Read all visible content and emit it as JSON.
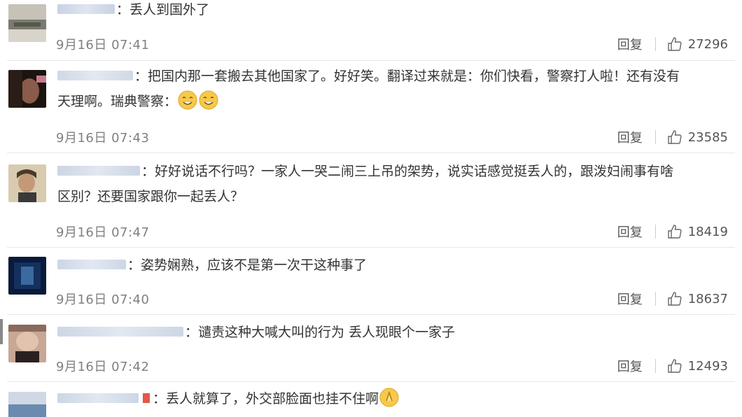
{
  "comments": [
    {
      "text": "：丢人到国外了",
      "time": "9月16日 07:41",
      "reply": "回复",
      "likes": "27296",
      "avatar_colors": [
        "#7a7a70",
        "#c7c2b8"
      ]
    },
    {
      "text": "：把国内那一套搬去其他国家了。好好笑。翻译过来就是：你们快看，警察打人啦！还有没有",
      "text2": "天理啊。瑞典警察：",
      "time": "9月16日 07:43",
      "reply": "回复",
      "likes": "23585",
      "avatar_colors": [
        "#1c1410",
        "#8a5a4a"
      ]
    },
    {
      "text": "：好好说话不行吗？一家人一哭二闹三上吊的架势，说实话感觉挺丢人的，跟泼妇闹事有啥",
      "text2": "区别？还要国家跟你一起丢人？",
      "time": "9月16日 07:47",
      "reply": "回复",
      "likes": "18419",
      "avatar_colors": [
        "#d9cbb0",
        "#4a3a2a"
      ]
    },
    {
      "text": "：姿势娴熟，应该不是第一次干这种事了",
      "time": "9月16日 07:40",
      "reply": "回复",
      "likes": "18637",
      "avatar_colors": [
        "#0a1a3a",
        "#3a6aa0"
      ]
    },
    {
      "text": "：谴责这种大喊大叫的行为 丢人现眼个一家子",
      "time": "9月16日 07:42",
      "reply": "回复",
      "likes": "12493",
      "avatar_colors": [
        "#c8a894",
        "#2a2020"
      ]
    },
    {
      "text": "：丢人就算了，外交部脸面也挂不住啊",
      "avatar_colors": [
        "#6a8ab0",
        "#cfd8e4"
      ]
    }
  ]
}
